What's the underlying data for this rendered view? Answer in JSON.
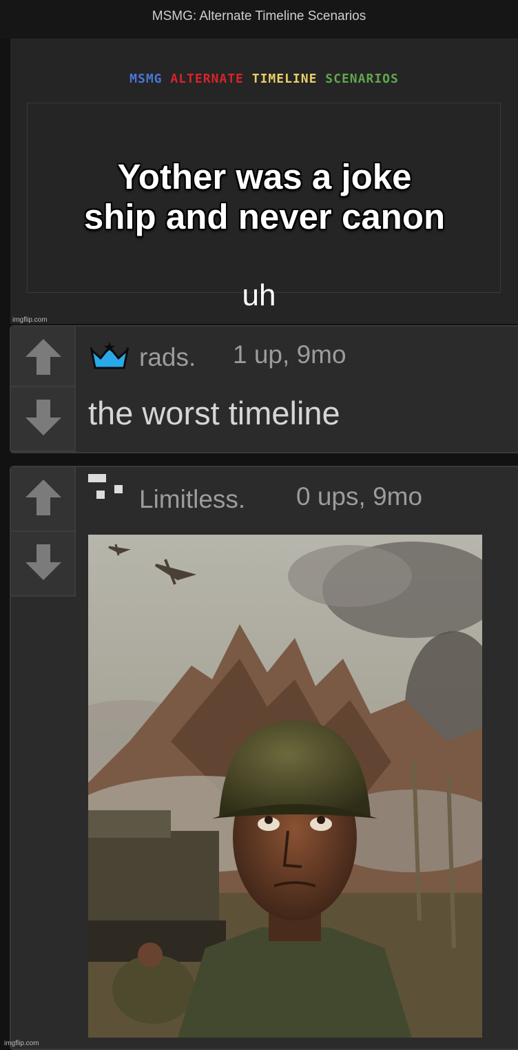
{
  "header": {
    "title": "MSMG: Alternate Timeline Scenarios"
  },
  "meme": {
    "logo": {
      "w1": "MSMG",
      "w2": "ALTERNATE",
      "w3": "TIMELINE",
      "w4": "SCENARIOS",
      "colors": {
        "w1": "#4a76d6",
        "w2": "#d8242a",
        "w3": "#e9cf6a",
        "w4": "#63a64f"
      }
    },
    "caption_line1": "Yother was a joke",
    "caption_line2": "ship and never canon",
    "bottom_text": "uh",
    "watermark": "imgflip.com"
  },
  "comments": [
    {
      "username": "rads.",
      "meta": "1 up, 9mo",
      "text": "the worst timeline",
      "badge_icon": "crown-icon"
    },
    {
      "username": "Limitless.",
      "meta": "0 ups, 9mo",
      "badge_icon": "pixel-block-icon",
      "image_alt": "painting of soldier with helmet in battlefield"
    }
  ],
  "footer": {
    "watermark": "imgflip.com"
  }
}
